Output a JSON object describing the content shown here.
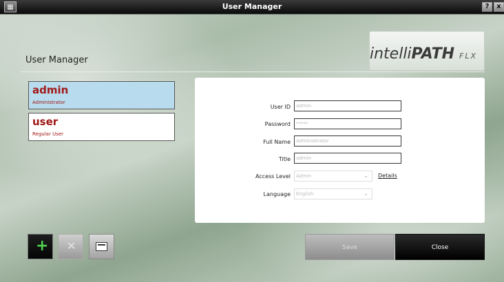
{
  "window": {
    "title": "User Manager",
    "help_label": "?",
    "close_label": "x"
  },
  "logo": {
    "prefix": "intelli",
    "main": "PATH",
    "suffix": "FLX"
  },
  "page": {
    "title": "User Manager"
  },
  "users": [
    {
      "name": "admin",
      "role": "Administrator",
      "selected": true
    },
    {
      "name": "user",
      "role": "Regular User",
      "selected": false
    }
  ],
  "form": {
    "user_id": {
      "label": "User ID",
      "value": "admin"
    },
    "password": {
      "label": "Password",
      "value": "*****"
    },
    "full_name": {
      "label": "Full Name",
      "value": "Administrator"
    },
    "title": {
      "label": "Title",
      "value": "admin"
    },
    "access_level": {
      "label": "Access Level",
      "value": "Admin"
    },
    "language": {
      "label": "Language",
      "value": "English"
    },
    "details_link": "Details"
  },
  "buttons": {
    "save": "Save",
    "close": "Close"
  },
  "icons": {
    "add": "plus-icon",
    "delete": "delete-icon",
    "edit": "edit-icon"
  },
  "colors": {
    "selected_user_bg": "#b8dced",
    "user_name": "#a01818",
    "add_icon": "#4fd24f"
  }
}
